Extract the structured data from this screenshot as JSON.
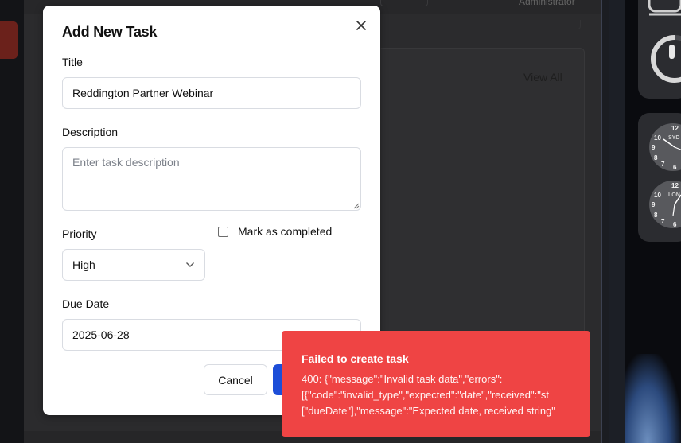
{
  "background": {
    "header_role": "Administrator",
    "view_all_label": "View All"
  },
  "modal": {
    "title": "Add New Task",
    "close_icon": "close-icon",
    "fields": {
      "title_label": "Title",
      "title_value": "Reddington Partner Webinar",
      "description_label": "Description",
      "description_placeholder": "Enter task description",
      "priority_label": "Priority",
      "priority_value": "High",
      "completed_label": "Mark as completed",
      "completed_checked": false,
      "due_date_label": "Due Date",
      "due_date_value": "2025-06-28"
    },
    "buttons": {
      "cancel_label": "Cancel"
    }
  },
  "toast": {
    "title": "Failed to create task",
    "lines": [
      "400: {\"message\":\"Invalid task data\",\"errors\":",
      "[{\"code\":\"invalid_type\",\"expected\":\"date\",\"received\":\"st",
      "[\"dueDate\"],\"message\":\"Expected date, received string\""
    ],
    "color": "#ef4444"
  },
  "desktop_widgets": {
    "clocks": [
      {
        "city": "SYD",
        "numbers": [
          "12",
          "10",
          "9",
          "8",
          "7",
          "6"
        ]
      },
      {
        "city": "LON",
        "numbers": [
          "12",
          "10",
          "9",
          "8",
          "7",
          "6"
        ]
      }
    ]
  },
  "colors": {
    "primary_button": "#1d4ed8",
    "overlay_bg": "#2b2b2d"
  }
}
